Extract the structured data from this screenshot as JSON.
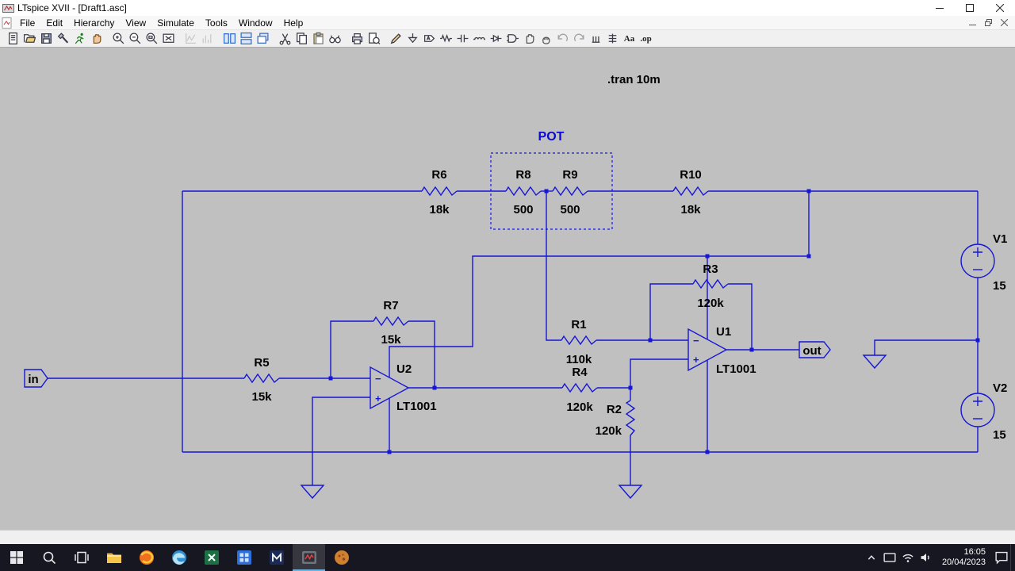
{
  "window": {
    "title": "LTspice XVII - [Draft1.asc]"
  },
  "menu": {
    "items": [
      "File",
      "Edit",
      "Hierarchy",
      "View",
      "Simulate",
      "Tools",
      "Window",
      "Help"
    ]
  },
  "toolbar": {
    "groups": [
      [
        "new-schematic",
        "open",
        "save",
        "control-panel",
        "run",
        "halt"
      ],
      [
        "zoom-in",
        "zoom-out",
        "zoom-area",
        "zoom-fit"
      ],
      [
        "autorange",
        "plot-settings"
      ],
      [
        "tile-vertical",
        "tile-horizontal",
        "cascade"
      ],
      [
        "cut",
        "copy",
        "paste",
        "find"
      ],
      [
        "print",
        "print-preview"
      ],
      [
        "wire",
        "ground",
        "label-net",
        "resistor",
        "capacitor",
        "inductor",
        "diode",
        "component",
        "move",
        "drag",
        "undo",
        "redo",
        "rotate",
        "mirror",
        "text",
        "spice-directive"
      ]
    ],
    "disabled": [
      "autorange",
      "plot-settings",
      "undo",
      "redo"
    ],
    "text_label": "Aa",
    "directive_label": ".op"
  },
  "schematic": {
    "directive": ".tran 10m",
    "pot_label": "POT",
    "port_in": "in",
    "port_out": "out",
    "sym": {
      "plus": "+",
      "minus": "−"
    },
    "resistors": [
      {
        "ref": "R6",
        "value": "18k"
      },
      {
        "ref": "R8",
        "value": "500"
      },
      {
        "ref": "R9",
        "value": "500"
      },
      {
        "ref": "R10",
        "value": "18k"
      },
      {
        "ref": "R3",
        "value": "120k"
      },
      {
        "ref": "R7",
        "value": "15k"
      },
      {
        "ref": "R1",
        "value": "110k"
      },
      {
        "ref": "R5",
        "value": "15k"
      },
      {
        "ref": "R4",
        "value": "120k"
      },
      {
        "ref": "R2",
        "value": "120k"
      }
    ],
    "opamps": [
      {
        "ref": "U2",
        "part": "LT1001"
      },
      {
        "ref": "U1",
        "part": "LT1001"
      }
    ],
    "sources": [
      {
        "ref": "V1",
        "value": "15"
      },
      {
        "ref": "V2",
        "value": "15"
      }
    ],
    "colors": {
      "wire": "#1616d6",
      "background": "#c0c0c0",
      "label": "#000000",
      "pot_label": "#0a0ad0"
    }
  },
  "taskbar": {
    "apps": [
      "start",
      "search",
      "task-view",
      "file-explorer",
      "firefox",
      "edge",
      "excel",
      "app-blue",
      "app-m",
      "ltspice",
      "app-orange"
    ],
    "active_app": "ltspice",
    "tray": [
      "tray-chevron",
      "tray-tablet",
      "tray-network",
      "tray-volume"
    ],
    "time": "16:05",
    "date": "20/04/2023"
  }
}
